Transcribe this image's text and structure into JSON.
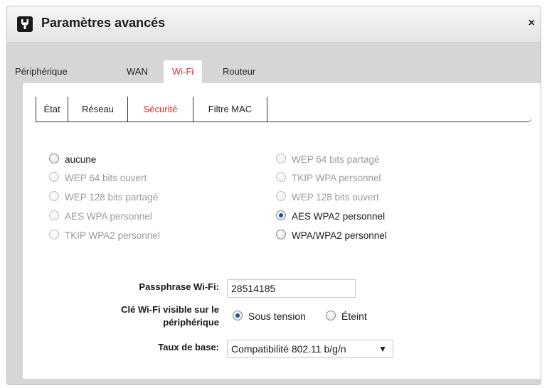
{
  "dialog": {
    "title": "Paramètres avancés",
    "close_glyph": "×",
    "app_icon": "wrench-icon"
  },
  "main_tabs": [
    "Périphérique",
    "WAN",
    "Wi-Fi",
    "Routeur"
  ],
  "main_tab_active": "Wi-Fi",
  "sub_tabs": [
    "État",
    "Réseau",
    "Sécurité",
    "Filtre MAC"
  ],
  "sub_tab_active": "Sécurité",
  "security_options": [
    {
      "label": "aucune",
      "enabled": true,
      "selected": false
    },
    {
      "label": "WEP 64 bits ouvert",
      "enabled": false,
      "selected": false
    },
    {
      "label": "WEP 128 bits partagé",
      "enabled": false,
      "selected": false
    },
    {
      "label": "AES WPA personnel",
      "enabled": false,
      "selected": false
    },
    {
      "label": "TKIP WPA2 personnel",
      "enabled": false,
      "selected": false
    },
    {
      "label": "WEP 64 bits partagé",
      "enabled": false,
      "selected": false
    },
    {
      "label": "TKIP WPA personnel",
      "enabled": false,
      "selected": false
    },
    {
      "label": "WEP 128 bits ouvert",
      "enabled": false,
      "selected": false
    },
    {
      "label": "AES WPA2 personnel",
      "enabled": true,
      "selected": true
    },
    {
      "label": "WPA/WPA2 personnel",
      "enabled": true,
      "selected": false
    }
  ],
  "form": {
    "passphrase_label": "Passphrase Wi-Fi:",
    "passphrase_value": "28514185",
    "visible_label_line1": "Clé Wi-Fi visible sur le",
    "visible_label_line2": "périphérique",
    "visible_on": "Sous tension",
    "visible_off": "Éteint",
    "visible_selected": "Sous tension",
    "rate_label": "Taux de base:",
    "rate_value": "Compatibilité 802.11 b/g/n"
  },
  "colors": {
    "accent_red": "#e0302a",
    "radio_selected": "#1c4fb3",
    "disabled_text": "#9a9a9a"
  }
}
